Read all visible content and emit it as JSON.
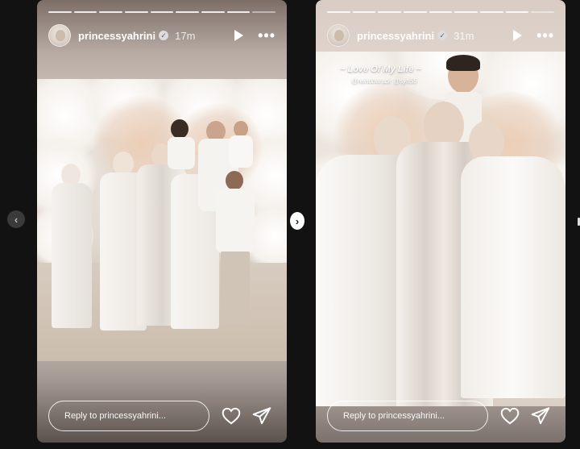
{
  "stories": [
    {
      "username": "princessyahrini",
      "time": "17m",
      "reply_placeholder": "Reply to princessyahrini..."
    },
    {
      "username": "princessyahrini",
      "time": "31m",
      "caption_title": "~ Love Of My Life ~",
      "caption_tags": "@reinobarack @syh55",
      "reply_placeholder": "Reply to princessyahrini..."
    }
  ],
  "icons": {
    "verified": "verified-badge-icon",
    "play": "play-icon",
    "more": "more-options-icon",
    "like": "heart-icon",
    "share": "send-icon",
    "prev": "chevron-left-icon",
    "next": "chevron-right-icon"
  },
  "colors": {
    "stage_background": "#121212",
    "story_text": "#ffffff"
  }
}
